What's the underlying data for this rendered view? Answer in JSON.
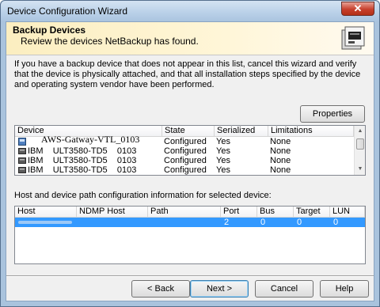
{
  "window": {
    "title": "Device Configuration Wizard",
    "close_glyph": "✕"
  },
  "header": {
    "title": "Backup Devices",
    "subtitle": "Review the devices NetBackup has found."
  },
  "description": "If you have a backup device that does not appear in this list, cancel this wizard and verify that the device is physically attached, and that all installation steps specified by the device and operating system vendor have been performed.",
  "properties_label": "Properties",
  "devices": {
    "columns": [
      "Device",
      "State",
      "Serialized",
      "Limitations"
    ],
    "rows": [
      {
        "device": "AWS-Gatway-VTL_0103",
        "state": "Configured",
        "serialized": "Yes",
        "limitations": "None",
        "overlay": true
      },
      {
        "device": "IBM    ULT3580-TD5    0103",
        "state": "Configured",
        "serialized": "Yes",
        "limitations": "None"
      },
      {
        "device": "IBM    ULT3580-TD5    0103",
        "state": "Configured",
        "serialized": "Yes",
        "limitations": "None"
      },
      {
        "device": "IBM    ULT3580-TD5    0103",
        "state": "Configured",
        "serialized": "Yes",
        "limitations": "None"
      }
    ]
  },
  "paths_label": "Host and device path configuration information for selected device:",
  "paths": {
    "columns": [
      "Host",
      "NDMP Host",
      "Path",
      "Port",
      "Bus",
      "Target",
      "LUN"
    ],
    "rows": [
      {
        "host": "",
        "ndmp": "",
        "path": "",
        "port": "2",
        "bus": "0",
        "target": "0",
        "lun": "0"
      }
    ]
  },
  "buttons": {
    "back": "< Back",
    "next": "Next >",
    "cancel": "Cancel",
    "help": "Help"
  }
}
